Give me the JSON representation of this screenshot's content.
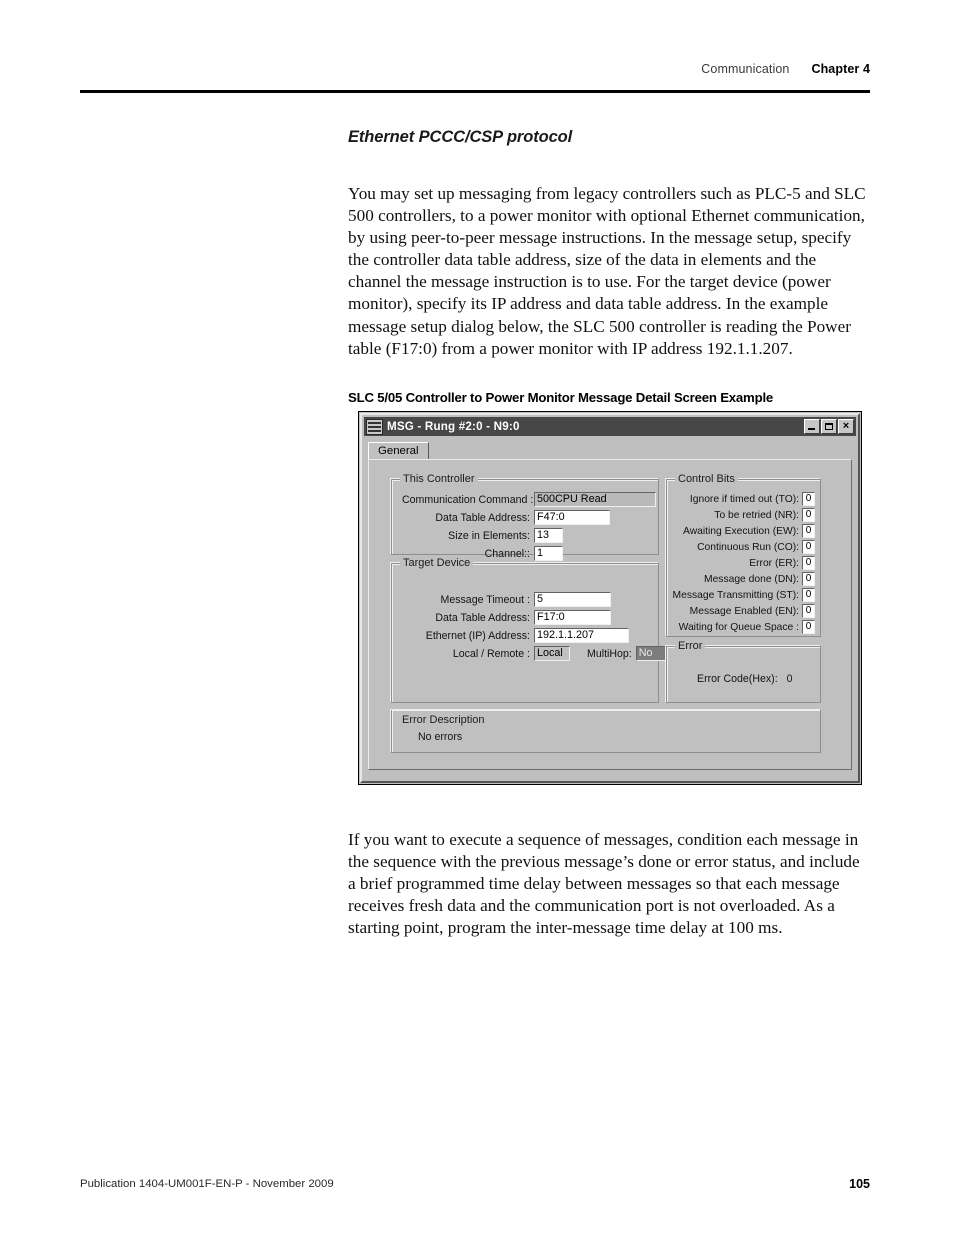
{
  "header": {
    "section": "Communication",
    "chapter": "Chapter 4"
  },
  "content": {
    "section_heading": "Ethernet PCCC/CSP protocol",
    "intro_paragraph": "You may set up messaging from legacy controllers such as PLC-5 and SLC 500 controllers, to a power monitor with optional Ethernet communication, by using peer-to-peer message instructions. In the message setup, specify the controller data table address, size of the data in elements and the channel the message instruction is to use. For the target device (power monitor), specify its IP address and data table address. In the example message setup dialog below, the SLC 500 controller is reading the Power table (F17:0) from a power monitor with IP address 192.1.1.207.",
    "figure_caption": "SLC 5/05 Controller to Power Monitor Message Detail Screen Example",
    "closing_paragraph": "If you want to execute a sequence of messages, condition each message in the sequence with the previous message’s done or error status, and include a brief programmed time delay between messages so that each message receives fresh data and the communication port is not overloaded. As a starting point, program the inter-message time delay at 100 ms."
  },
  "dialog": {
    "title": "MSG - Rung #2:0 - N9:0",
    "icon": "msg-block-icon",
    "window_buttons": {
      "minimize": "_",
      "maximize": "□",
      "close": "×"
    },
    "tabs": [
      {
        "label": "General",
        "active": true
      }
    ],
    "this_controller": {
      "title": "This Controller",
      "fields": [
        {
          "label": "Communication Command :",
          "value": "500CPU Read",
          "style": "readonly"
        },
        {
          "label": "Data Table Address:",
          "value": "F47:0",
          "style": "input"
        },
        {
          "label": "Size in Elements:",
          "value": "13",
          "style": "input"
        },
        {
          "label": "Channel::",
          "value": "1",
          "style": "input"
        }
      ]
    },
    "target_device": {
      "title": "Target Device",
      "fields": [
        {
          "label": "Message Timeout :",
          "value": "5",
          "style": "input"
        },
        {
          "label": "Data Table Address:",
          "value": "F17:0",
          "style": "input"
        },
        {
          "label": "Ethernet (IP) Address:",
          "value": "192.1.1.207",
          "style": "input"
        },
        {
          "label": "Local / Remote :",
          "value": "Local",
          "style": "sunken-light"
        }
      ],
      "multihop": {
        "label": "MultiHop:",
        "value": "No"
      }
    },
    "control_bits": {
      "title": "Control Bits",
      "bits": [
        {
          "label": "Ignore if timed out (TO):",
          "value": "0"
        },
        {
          "label": "To be retried (NR):",
          "value": "0"
        },
        {
          "label": "Awaiting Execution (EW):",
          "value": "0"
        },
        {
          "label": "Continuous Run (CO):",
          "value": "0"
        },
        {
          "label": "Error (ER):",
          "value": "0"
        },
        {
          "label": "Message done (DN):",
          "value": "0"
        },
        {
          "label": "Message Transmitting (ST):",
          "value": "0"
        },
        {
          "label": "Message Enabled (EN):",
          "value": "0"
        },
        {
          "label": "Waiting for Queue Space :",
          "value": "0"
        }
      ]
    },
    "error": {
      "title": "Error",
      "code_label": "Error Code(Hex):",
      "code_value": "0"
    },
    "error_description": {
      "title": "Error Description",
      "text": "No errors"
    }
  },
  "footer": {
    "publication": "Publication 1404-UM001F-EN-P - November 2009",
    "page_number": "105"
  }
}
